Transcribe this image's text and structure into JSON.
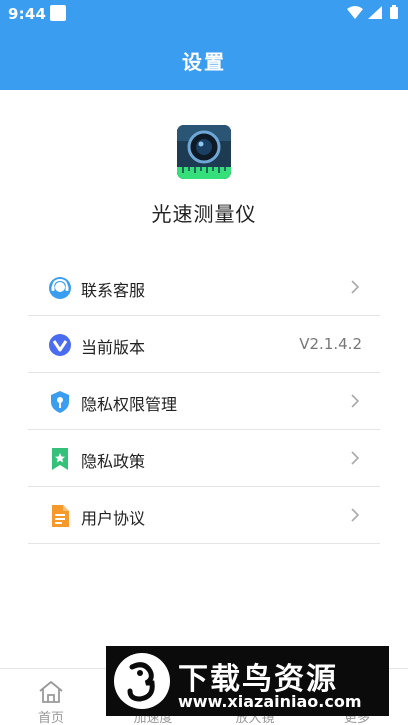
{
  "status_bar": {
    "time": "9:44",
    "icons": [
      "notification-icon",
      "wifi-icon",
      "signal-icon",
      "battery-icon"
    ]
  },
  "header": {
    "title": "设置"
  },
  "app": {
    "name": "光速测量仪",
    "logo_icon": "camera-lens-icon"
  },
  "menu": {
    "items": [
      {
        "label": "联系客服",
        "icon": "customer-service-icon",
        "accent": "#3a9df0"
      },
      {
        "label": "当前版本",
        "icon": "version-icon",
        "value": "V2.1.4.2",
        "accent": "#4a6cf0"
      },
      {
        "label": "隐私权限管理",
        "icon": "shield-icon",
        "accent": "#3a9df0"
      },
      {
        "label": "隐私政策",
        "icon": "bookmark-star-icon",
        "accent": "#35c17a"
      },
      {
        "label": "用户协议",
        "icon": "document-icon",
        "accent": "#f59a2a"
      }
    ]
  },
  "tabs": [
    {
      "label": "首页",
      "icon": "home-icon"
    },
    {
      "label": "加速度",
      "icon": "speed-icon"
    },
    {
      "label": "放大镜",
      "icon": "magnifier-icon"
    },
    {
      "label": "更多",
      "icon": "more-icon"
    }
  ],
  "watermark": {
    "text": "下载鸟资源",
    "url": "www.xiazainiao.com"
  },
  "colors": {
    "primary": "#3a9df0",
    "divider": "#e4e4e4",
    "tab_inactive": "#999999"
  }
}
